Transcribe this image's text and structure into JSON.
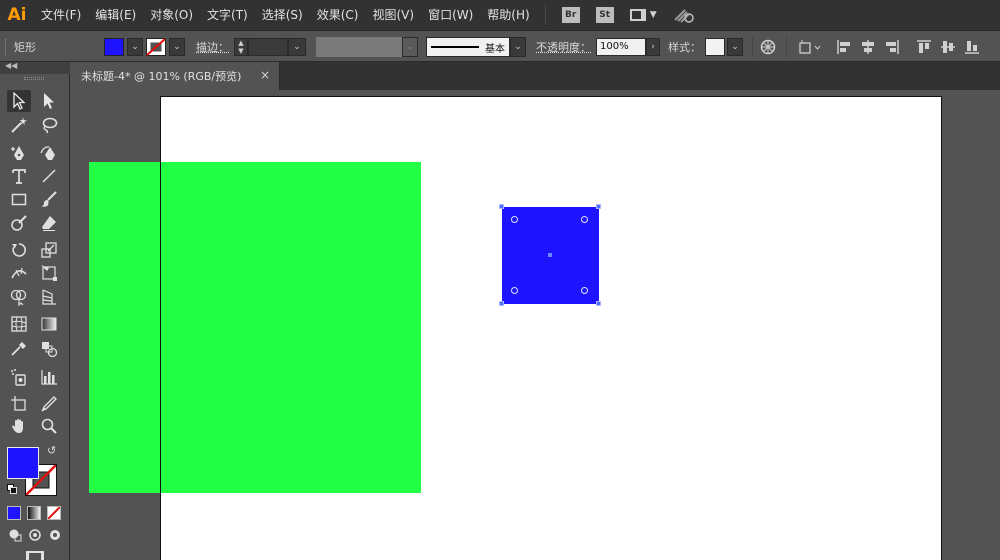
{
  "app": {
    "logo": "Ai"
  },
  "menu": [
    "文件(F)",
    "编辑(E)",
    "对象(O)",
    "文字(T)",
    "选择(S)",
    "效果(C)",
    "视图(V)",
    "窗口(W)",
    "帮助(H)"
  ],
  "app_icons": {
    "bridge": "Br",
    "stock": "St"
  },
  "control_bar": {
    "tool_name": "矩形",
    "fill_color": "#1f14ff",
    "stroke_label": "描边：",
    "stroke_weight": "",
    "brush_label": "基本",
    "opacity_label": "不透明度：",
    "opacity_value": "100%",
    "style_label": "样式："
  },
  "document": {
    "tab_title": "未标题-4* @ 101% (RGB/预览)",
    "close": "×"
  },
  "canvas": {
    "artboard_color": "#ffffff",
    "green_rect_color": "#22ff44",
    "blue_rect_color": "#1f14ff"
  },
  "colors": {
    "menubar": "#323232",
    "panel": "#535353",
    "accent_logo": "#ff9a00"
  }
}
